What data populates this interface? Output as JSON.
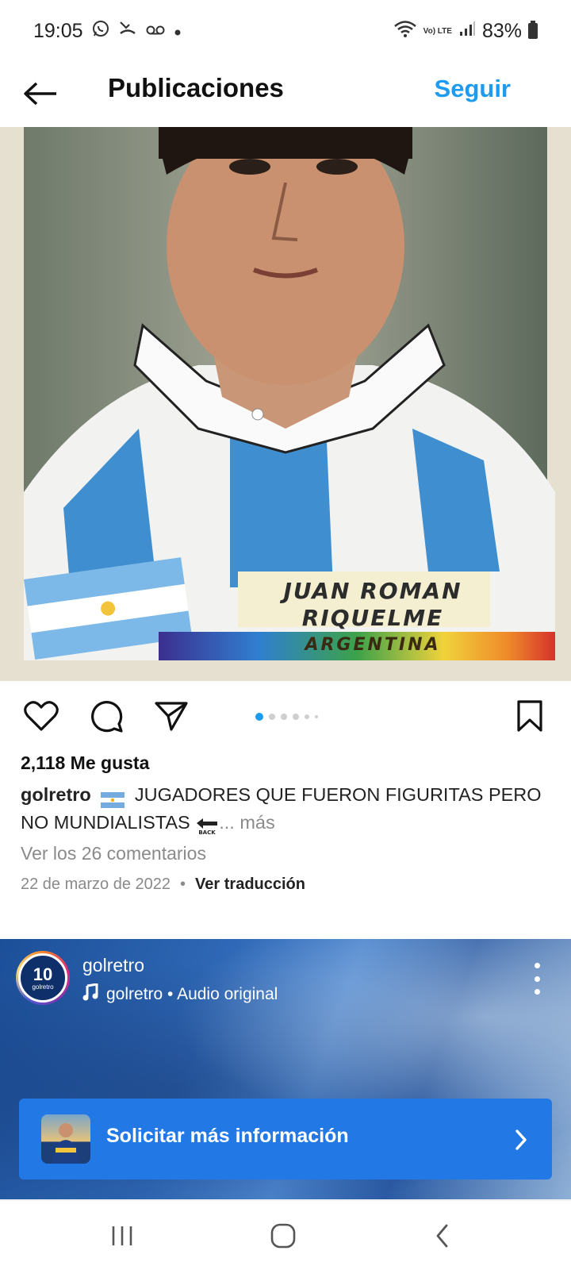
{
  "status_bar": {
    "time": "19:05",
    "battery": "83%",
    "network": "Vo) LTE",
    "icons": [
      "whatsapp-icon",
      "missed-call-icon",
      "voicemail-icon",
      "dot-icon",
      "wifi-icon",
      "signal-icon",
      "battery-icon"
    ]
  },
  "header": {
    "title": "Publicaciones",
    "follow_label": "Seguir",
    "accent": "#1d9bf0"
  },
  "post": {
    "image_text": {
      "name_line1": "JUAN ROMAN",
      "name_line2": "RIQUELME",
      "country": "ARGENTINA"
    },
    "carousel": {
      "total": 6,
      "active": 1
    },
    "likes": "2,118 Me gusta",
    "caption": {
      "user": "golretro",
      "text": "JUGADORES QUE FUERON FIGURITAS PERO NO MUNDIALISTAS",
      "more": "... más"
    },
    "comments_link": "Ver los 26 comentarios",
    "date": "22 de marzo de 2022",
    "separator": "•",
    "translate": "Ver traducción"
  },
  "reel": {
    "avatar_text": "10",
    "avatar_subtext": "golretro",
    "username": "golretro",
    "audio": "golretro • Audio original",
    "cta_label": "Solicitar más información",
    "cta_color": "#2279e6"
  }
}
